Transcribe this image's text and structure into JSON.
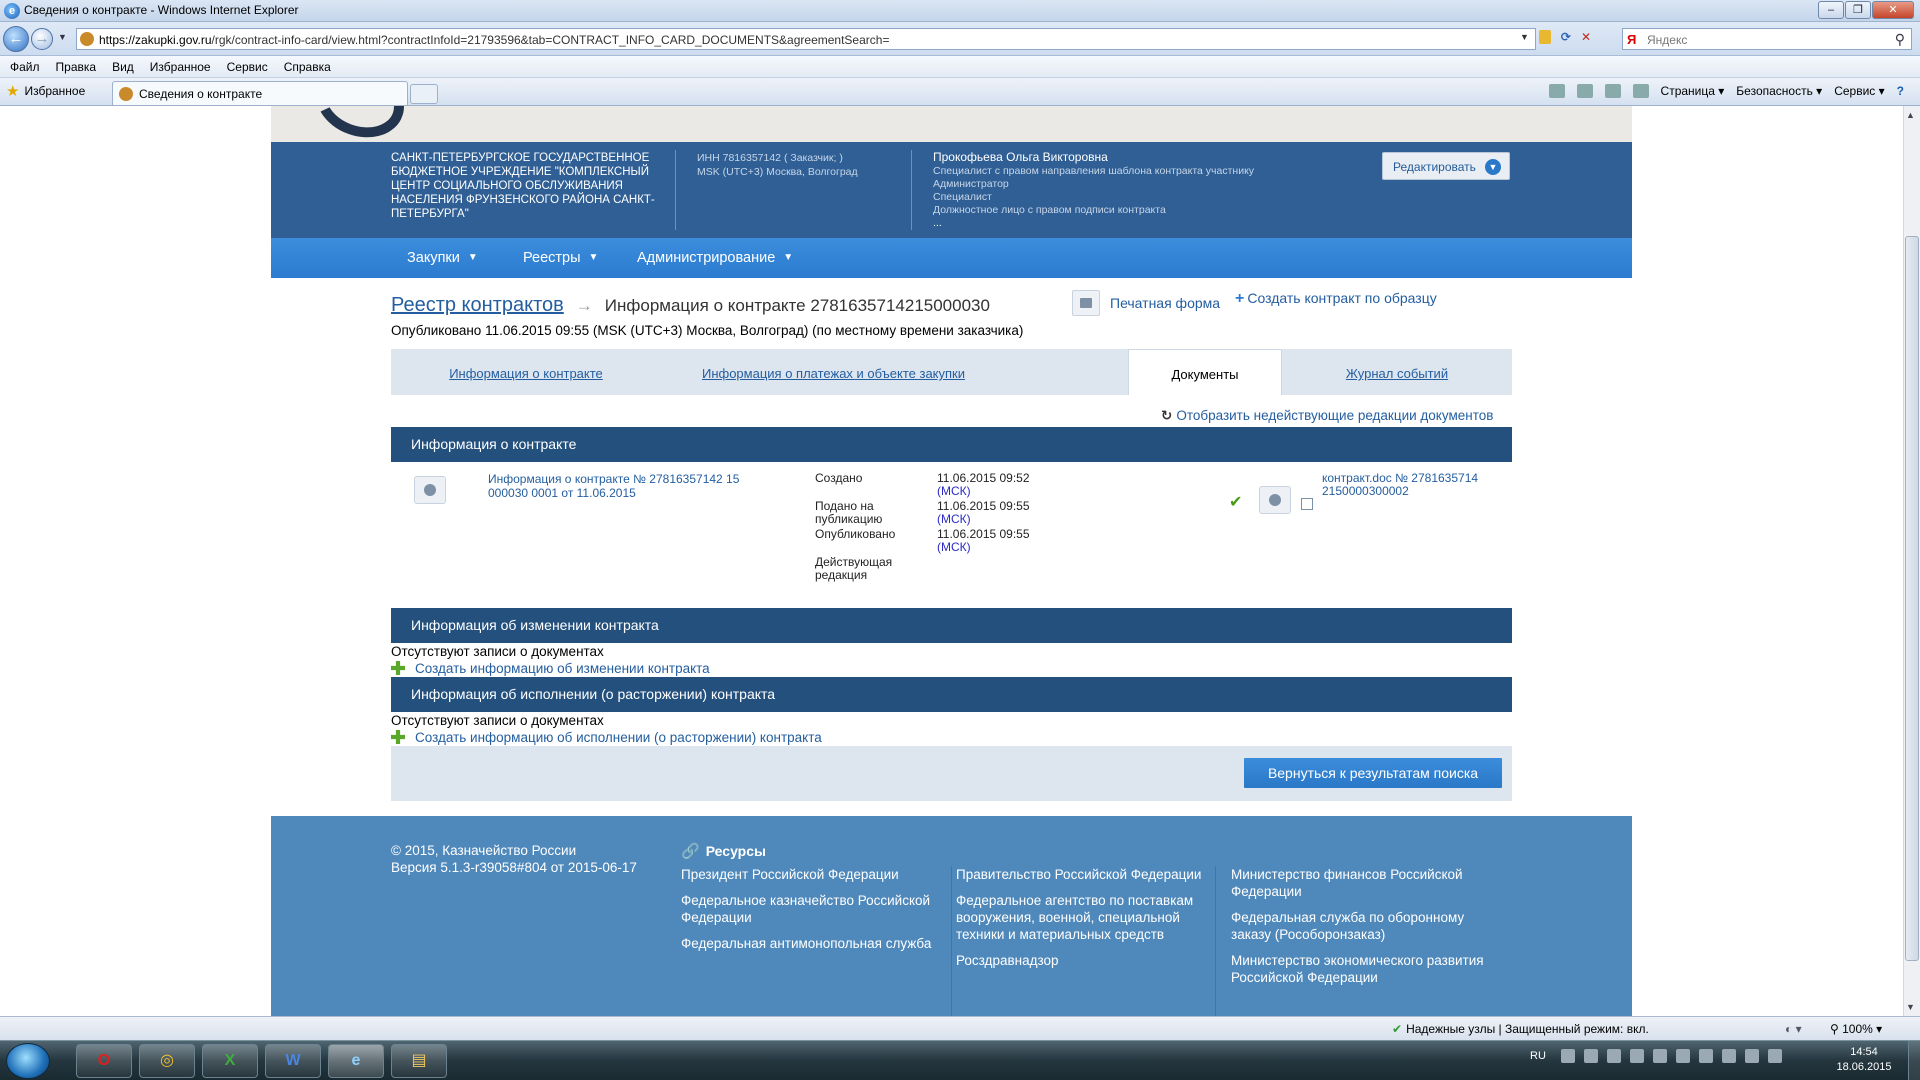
{
  "window": {
    "title": "Сведения о контракте - Windows Internet Explorer"
  },
  "address": {
    "host": "https://zakupki.gov.ru",
    "path": "/rgk/contract-info-card/view.html?contractInfoId=21793596&tab=CONTRACT_INFO_CARD_DOCUMENTS&agreementSearch="
  },
  "search": {
    "engine_mark": "Я",
    "placeholder": "Яндекс"
  },
  "menubar": [
    "Файл",
    "Правка",
    "Вид",
    "Избранное",
    "Сервис",
    "Справка"
  ],
  "favorites": {
    "label": "Избранное",
    "tab_title": "Сведения о контракте"
  },
  "commandbar": {
    "page": "Страница ▾",
    "security": "Безопасность ▾",
    "tools": "Сервис ▾"
  },
  "org": {
    "name": "САНКТ-ПЕТЕРБУРГСКОЕ ГОСУДАРСТВЕННОЕ БЮДЖЕТНОЕ УЧРЕЖДЕНИЕ \"КОМПЛЕКСНЫЙ ЦЕНТР СОЦИАЛЬНОГО ОБСЛУЖИВАНИЯ НАСЕЛЕНИЯ ФРУНЗЕНСКОГО РАЙОНА САНКТ-ПЕТЕРБУРГА\"",
    "inn": "ИНН 7816357142 ( Заказчик; )",
    "tz": "MSK (UTC+3) Москва, Волгоград"
  },
  "user": {
    "name": "Прокофьева Ольга Викторовна",
    "roles": [
      "Специалист с правом направления шаблона контракта участнику",
      "Администратор",
      "Специалист",
      "Должностное лицо с правом подписи контракта",
      "..."
    ],
    "edit_label": "Редактировать"
  },
  "nav": [
    "Закупки",
    "Реестры",
    "Администрирование"
  ],
  "breadcrumb": {
    "registry": "Реестр контрактов",
    "current": "Информация о контракте 2781635714215000030"
  },
  "actions": {
    "print": "Печатная форма",
    "create_by_sample": "Создать контракт по образцу"
  },
  "published_line": "Опубликовано 11.06.2015 09:55 (MSK (UTC+3) Москва, Волгоград) (по местному времени заказчика)",
  "tabs": [
    "Информация о контракте",
    "Информация о платежах и объекте закупки",
    "Документы",
    "Журнал событий"
  ],
  "show_inactive": "Отобразить недействующие редакции документов",
  "sections": {
    "contract_info": "Информация о контракте",
    "change_info": "Информация об изменении контракта",
    "execution_info": "Информация об исполнении (о расторжении) контракта"
  },
  "document": {
    "link": "Информация о контракте № 27816357142 15 000030 0001 от 11.06.2015",
    "meta": [
      {
        "label": "Создано",
        "value": "11.06.2015 09:52",
        "tz": "(МСК)"
      },
      {
        "label": "Подано на публикацию",
        "value": "11.06.2015 09:55",
        "tz": "(МСК)"
      },
      {
        "label": "Опубликовано",
        "value": "11.06.2015 09:55",
        "tz": "(МСК)"
      },
      {
        "label": "Действующая редакция",
        "value": "",
        "tz": ""
      }
    ],
    "file_link": "контракт.doc № 27816357142150000300002"
  },
  "no_records": "Отсутствуют записи о документах",
  "create_change": "Создать информацию об изменении контракта",
  "create_execution": "Создать информацию об исполнении (о расторжении) контракта",
  "return_button": "Вернуться к результатам поиска",
  "footer": {
    "copyright": "© 2015, Казначейство России",
    "version": "Версия 5.1.3-r39058#804 от 2015-06-17",
    "resources_title": "Ресурсы",
    "col1": [
      "Президент Российской Федерации",
      "Федеральное казначейство Российской Федерации",
      "Федеральная антимонопольная служба"
    ],
    "col2": [
      "Правительство Российской Федерации",
      "Федеральное агентство по поставкам вооружения, военной, специальной техники и материальных средств",
      "Росздравнадзор"
    ],
    "col3": [
      "Министерство финансов Российской Федерации",
      "Федеральная служба по оборонному заказу (Рособоронзаказ)",
      "Министерство экономического развития Российской Федерации"
    ]
  },
  "statusbar": {
    "trusted": "Надежные узлы | Защищенный режим: вкл.",
    "zoom": "100%"
  },
  "taskbar": {
    "lang": "RU",
    "time": "14:54",
    "date": "18.06.2015",
    "apps": [
      "O",
      "◎",
      "X",
      "W",
      "e",
      "▤"
    ]
  }
}
